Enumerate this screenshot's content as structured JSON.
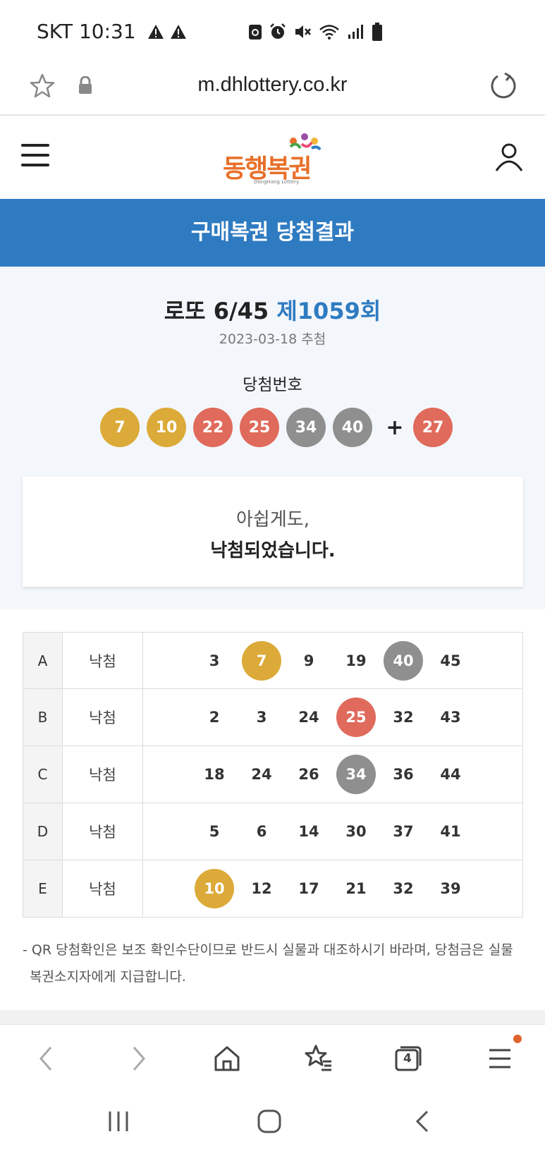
{
  "status_bar": {
    "carrier_time": "SKT 10:31"
  },
  "browser": {
    "url": "m.dhlottery.co.kr"
  },
  "site": {
    "logo_text": "동행복권",
    "logo_sub": "DongHang Lottery"
  },
  "banner": {
    "title": "구매복권 당첨결과"
  },
  "draw": {
    "game": "로또 6/45",
    "round": "제1059회",
    "date": "2023-03-18 추첨",
    "winning_label": "당첨번호",
    "winning_numbers": [
      {
        "value": "7",
        "color": "#dcaa38"
      },
      {
        "value": "10",
        "color": "#dcaa38"
      },
      {
        "value": "22",
        "color": "#e06a5b"
      },
      {
        "value": "25",
        "color": "#e06a5b"
      },
      {
        "value": "34",
        "color": "#8f8f8f"
      },
      {
        "value": "40",
        "color": "#8f8f8f"
      }
    ],
    "plus": "+",
    "bonus_number": {
      "value": "27",
      "color": "#e06a5b"
    }
  },
  "result": {
    "line1": "아쉽게도,",
    "line2": "낙첨되었습니다."
  },
  "ticket": [
    {
      "game": "A",
      "status": "낙첨",
      "numbers": [
        {
          "value": "3"
        },
        {
          "value": "7",
          "hit": "#dcaa38"
        },
        {
          "value": "9"
        },
        {
          "value": "19"
        },
        {
          "value": "40",
          "hit": "#8f8f8f"
        },
        {
          "value": "45"
        }
      ]
    },
    {
      "game": "B",
      "status": "낙첨",
      "numbers": [
        {
          "value": "2"
        },
        {
          "value": "3"
        },
        {
          "value": "24"
        },
        {
          "value": "25",
          "hit": "#e06a5b"
        },
        {
          "value": "32"
        },
        {
          "value": "43"
        }
      ]
    },
    {
      "game": "C",
      "status": "낙첨",
      "numbers": [
        {
          "value": "18"
        },
        {
          "value": "24"
        },
        {
          "value": "26"
        },
        {
          "value": "34",
          "hit": "#8f8f8f"
        },
        {
          "value": "36"
        },
        {
          "value": "44"
        }
      ]
    },
    {
      "game": "D",
      "status": "낙첨",
      "numbers": [
        {
          "value": "5"
        },
        {
          "value": "6"
        },
        {
          "value": "14"
        },
        {
          "value": "30"
        },
        {
          "value": "37"
        },
        {
          "value": "41"
        }
      ]
    },
    {
      "game": "E",
      "status": "낙첨",
      "numbers": [
        {
          "value": "10",
          "hit": "#dcaa38"
        },
        {
          "value": "12"
        },
        {
          "value": "17"
        },
        {
          "value": "21"
        },
        {
          "value": "32"
        },
        {
          "value": "39"
        }
      ]
    }
  ],
  "note": {
    "line1": "- QR 당첨확인은 보조 확인수단이므로 반드시 실물과 대조하시기 바라며, 당첨금은 실물",
    "line2": "복권소지자에게 지급합니다."
  },
  "browser_nav": {
    "tabs_count": "4"
  },
  "colors": {
    "banner_blue": "#2f7bc1",
    "gold": "#dcaa38",
    "red": "#e06a5b",
    "gray": "#8f8f8f"
  }
}
